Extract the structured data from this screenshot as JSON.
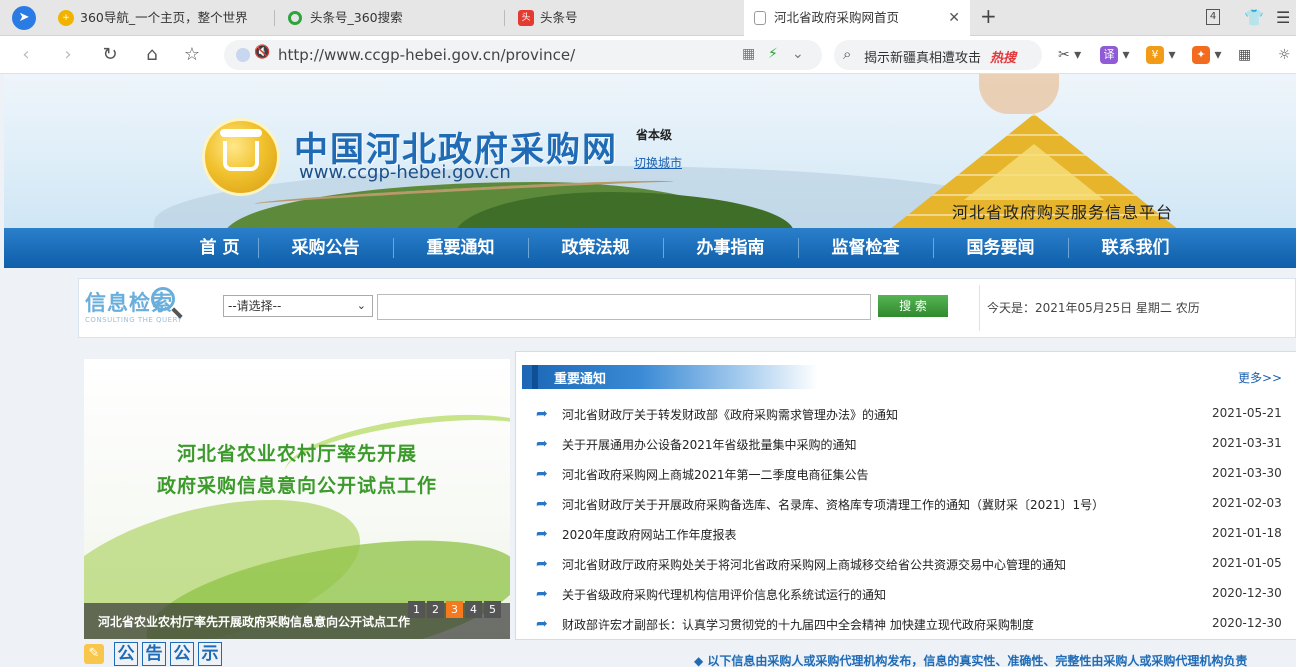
{
  "browser": {
    "tabs": [
      {
        "label": "360导航_一个主页，整个世界",
        "icon": "360-nav-icon"
      },
      {
        "label": "头条号_360搜索",
        "icon": "360-search-icon"
      },
      {
        "label": "头条号",
        "icon": "toutiao-icon"
      },
      {
        "label": "河北省政府采购网首页",
        "icon": "page-icon"
      }
    ],
    "tab_count": "4",
    "url": "http://www.ccgp-hebei.gov.cn/province/",
    "search_text": "揭示新疆真相遭攻击",
    "hot_label": "热搜"
  },
  "site": {
    "title": "中国河北政府采购网",
    "domain": "www.ccgp-hebei.gov.cn",
    "level": "省本级",
    "switch_city": "切换城市",
    "platform": "河北省政府购买服务信息平台"
  },
  "nav": [
    "首 页",
    "采购公告",
    "重要通知",
    "政策法规",
    "办事指南",
    "监督检查",
    "国务要闻",
    "联系我们"
  ],
  "search": {
    "logo": "信息检索",
    "logo_sub": "CONSULTING THE QUERY",
    "select_value": "--请选择--",
    "button": "搜 索",
    "today": "今天是：2021年05月25日 星期二 农历"
  },
  "slider": {
    "line1": "河北省农业农村厅率先开展",
    "line2": "政府采购信息意向公开试点工作",
    "caption": "河北省农业农村厅率先开展政府采购信息意向公开试点工作",
    "pages": [
      "1",
      "2",
      "3",
      "4",
      "5"
    ],
    "active_page": 3
  },
  "notices": {
    "title": "重要通知",
    "more": "更多>>",
    "items": [
      {
        "title": "河北省财政厅关于转发财政部《政府采购需求管理办法》的通知",
        "date": "2021-05-21"
      },
      {
        "title": "关于开展通用办公设备2021年省级批量集中采购的通知",
        "date": "2021-03-31"
      },
      {
        "title": "河北省政府采购网上商城2021年第一二季度电商征集公告",
        "date": "2021-03-30"
      },
      {
        "title": "河北省财政厅关于开展政府采购备选库、名录库、资格库专项清理工作的通知（冀财采〔2021〕1号）",
        "date": "2021-02-03"
      },
      {
        "title": "2020年度政府网站工作年度报表",
        "date": "2021-01-18"
      },
      {
        "title": "河北省财政厅政府采购处关于将河北省政府采购网上商城移交给省公共资源交易中心管理的通知",
        "date": "2021-01-05"
      },
      {
        "title": "关于省级政府采购代理机构信用评价信息化系统试运行的通知",
        "date": "2020-12-30"
      },
      {
        "title": "财政部许宏才副部长：认真学习贯彻党的十九届四中全会精神 加快建立现代政府采购制度",
        "date": "2020-12-30"
      }
    ]
  },
  "announce": {
    "chars": [
      "公",
      "告",
      "公",
      "示"
    ],
    "marquee": "◆ 以下信息由采购人或采购代理机构发布，信息的真实性、准确性、完整性由采购人或采购代理机构负责"
  }
}
